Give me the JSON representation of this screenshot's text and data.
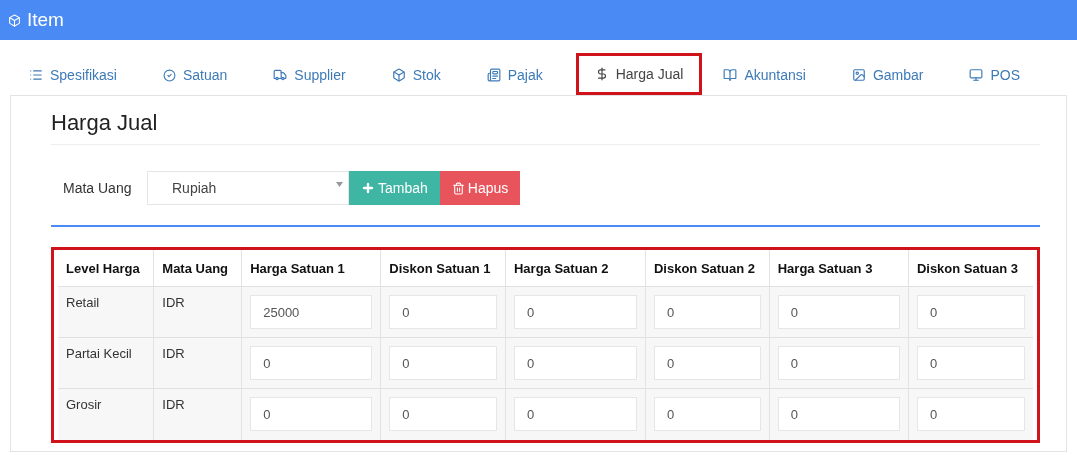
{
  "window": {
    "title": "Item"
  },
  "tabs": [
    {
      "label": "Spesifikasi",
      "selected": false,
      "highlighted": false
    },
    {
      "label": "Satuan",
      "selected": false,
      "highlighted": false
    },
    {
      "label": "Supplier",
      "selected": false,
      "highlighted": false
    },
    {
      "label": "Stok",
      "selected": false,
      "highlighted": false
    },
    {
      "label": "Pajak",
      "selected": false,
      "highlighted": false
    },
    {
      "label": "Harga Jual",
      "selected": true,
      "highlighted": true
    },
    {
      "label": "Akuntansi",
      "selected": false,
      "highlighted": false
    },
    {
      "label": "Gambar",
      "selected": false,
      "highlighted": false
    },
    {
      "label": "POS",
      "selected": false,
      "highlighted": false
    }
  ],
  "section_title": "Harga Jual",
  "currency": {
    "label": "Mata Uang",
    "value": "Rupiah"
  },
  "buttons": [
    {
      "kind": "add",
      "label": "Tambah"
    },
    {
      "kind": "delete",
      "label": "Hapus"
    }
  ],
  "table": {
    "highlighted": true,
    "columns": [
      "Level Harga",
      "Mata Uang",
      "Harga Satuan 1",
      "Diskon Satuan 1",
      "Harga Satuan 2",
      "Diskon Satuan 2",
      "Harga Satuan 3",
      "Diskon Satuan 3"
    ],
    "rows": [
      {
        "level": "Retail",
        "currency": "IDR",
        "values": [
          "25000",
          "0",
          "0",
          "0",
          "0",
          "0"
        ]
      },
      {
        "level": "Partai Kecil",
        "currency": "IDR",
        "values": [
          "0",
          "0",
          "0",
          "0",
          "0",
          "0"
        ]
      },
      {
        "level": "Grosir",
        "currency": "IDR",
        "values": [
          "0",
          "0",
          "0",
          "0",
          "0",
          "0"
        ]
      }
    ]
  }
}
